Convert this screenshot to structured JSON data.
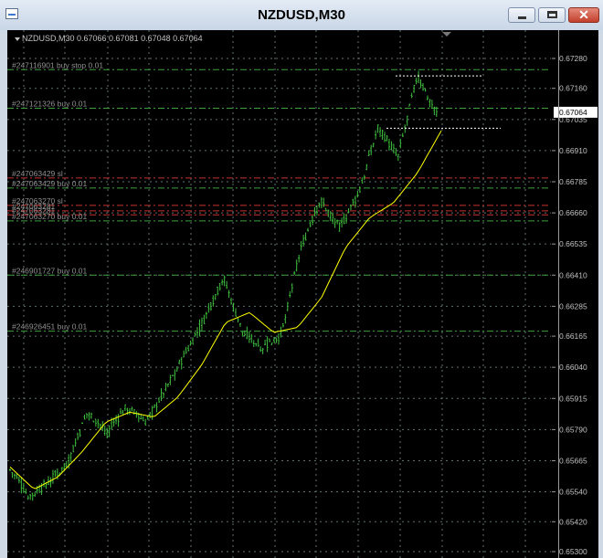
{
  "window": {
    "title": "NZDUSD,M30",
    "close_glyph": "✕"
  },
  "chart": {
    "symbol_info": "NZDUSD,M30  0.67066 0.67081 0.67048 0.67064",
    "current_price": "0.67064",
    "price_ticks": [
      "0.67280",
      "0.67160",
      "0.67035",
      "0.66910",
      "0.66785",
      "0.66660",
      "0.66535",
      "0.66410",
      "0.66285",
      "0.66165",
      "0.66040",
      "0.65915",
      "0.65790",
      "0.65665",
      "0.65540",
      "0.65420",
      "0.65300"
    ],
    "order_lines": [
      {
        "label": "#247116901 buy stop 0.01",
        "price": 0.67235,
        "kind": "order"
      },
      {
        "label": "#247121326 buy 0.01",
        "price": 0.6708,
        "kind": "order"
      },
      {
        "label": "#247063429 sl",
        "price": 0.668,
        "kind": "sl"
      },
      {
        "label": "#247063429 buy 0.01",
        "price": 0.6676,
        "kind": "order"
      },
      {
        "label": "#247063270 sl",
        "price": 0.6669,
        "kind": "sl"
      },
      {
        "label": "#247063281",
        "price": 0.66668,
        "kind": "sl"
      },
      {
        "label": "#247063281",
        "price": 0.66652,
        "kind": "sl"
      },
      {
        "label": "#247063270 buy 0.01",
        "price": 0.66628,
        "kind": "order"
      },
      {
        "label": "#246901727 buy 0.01",
        "price": 0.6641,
        "kind": "order"
      },
      {
        "label": "#246926451 buy 0.01",
        "price": 0.66185,
        "kind": "order"
      }
    ],
    "colors": {
      "background": "#000000",
      "grid": "#5f6f6f",
      "candle": "#3fbf3f",
      "ma": "#ffff00",
      "order_line": "#3fa03f",
      "sl_line": "#c83232",
      "price_text": "#c0c0c0",
      "label_text": "#8f8f8f"
    }
  },
  "chart_data": {
    "type": "line",
    "series": [
      {
        "price_anchors": [
          0.6563,
          0.6552,
          0.6558,
          0.6566,
          0.6586,
          0.6578,
          0.6588,
          0.6582,
          0.6595,
          0.6609,
          0.6623,
          0.664,
          0.6618,
          0.6612,
          0.6617,
          0.6652,
          0.6671,
          0.666,
          0.6674,
          0.6701,
          0.6688,
          0.6721,
          0.6706
        ]
      },
      {
        "ma_anchors": [
          0.6564,
          0.6555,
          0.656,
          0.657,
          0.6582,
          0.6586,
          0.6584,
          0.6592,
          0.6605,
          0.6622,
          0.6626,
          0.6618,
          0.662,
          0.6632,
          0.6652,
          0.6664,
          0.667,
          0.6682,
          0.6699
        ]
      }
    ],
    "ylim": [
      0.653,
      0.6728
    ]
  }
}
